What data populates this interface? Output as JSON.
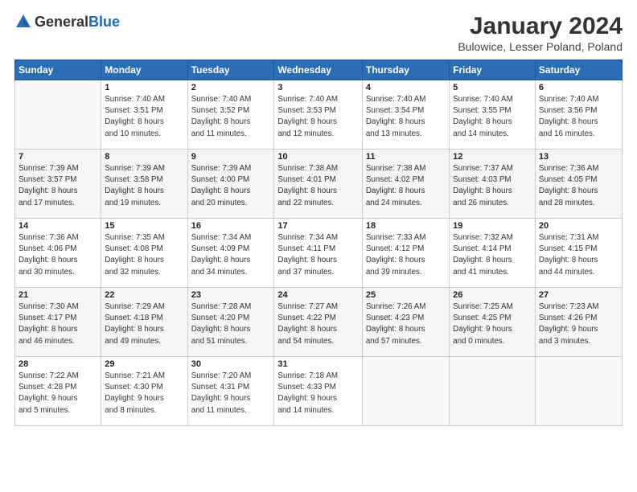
{
  "header": {
    "logo_general": "General",
    "logo_blue": "Blue",
    "month": "January 2024",
    "location": "Bulowice, Lesser Poland, Poland"
  },
  "weekdays": [
    "Sunday",
    "Monday",
    "Tuesday",
    "Wednesday",
    "Thursday",
    "Friday",
    "Saturday"
  ],
  "weeks": [
    [
      {
        "day": "",
        "info": ""
      },
      {
        "day": "1",
        "info": "Sunrise: 7:40 AM\nSunset: 3:51 PM\nDaylight: 8 hours\nand 10 minutes."
      },
      {
        "day": "2",
        "info": "Sunrise: 7:40 AM\nSunset: 3:52 PM\nDaylight: 8 hours\nand 11 minutes."
      },
      {
        "day": "3",
        "info": "Sunrise: 7:40 AM\nSunset: 3:53 PM\nDaylight: 8 hours\nand 12 minutes."
      },
      {
        "day": "4",
        "info": "Sunrise: 7:40 AM\nSunset: 3:54 PM\nDaylight: 8 hours\nand 13 minutes."
      },
      {
        "day": "5",
        "info": "Sunrise: 7:40 AM\nSunset: 3:55 PM\nDaylight: 8 hours\nand 14 minutes."
      },
      {
        "day": "6",
        "info": "Sunrise: 7:40 AM\nSunset: 3:56 PM\nDaylight: 8 hours\nand 16 minutes."
      }
    ],
    [
      {
        "day": "7",
        "info": "Sunrise: 7:39 AM\nSunset: 3:57 PM\nDaylight: 8 hours\nand 17 minutes."
      },
      {
        "day": "8",
        "info": "Sunrise: 7:39 AM\nSunset: 3:58 PM\nDaylight: 8 hours\nand 19 minutes."
      },
      {
        "day": "9",
        "info": "Sunrise: 7:39 AM\nSunset: 4:00 PM\nDaylight: 8 hours\nand 20 minutes."
      },
      {
        "day": "10",
        "info": "Sunrise: 7:38 AM\nSunset: 4:01 PM\nDaylight: 8 hours\nand 22 minutes."
      },
      {
        "day": "11",
        "info": "Sunrise: 7:38 AM\nSunset: 4:02 PM\nDaylight: 8 hours\nand 24 minutes."
      },
      {
        "day": "12",
        "info": "Sunrise: 7:37 AM\nSunset: 4:03 PM\nDaylight: 8 hours\nand 26 minutes."
      },
      {
        "day": "13",
        "info": "Sunrise: 7:36 AM\nSunset: 4:05 PM\nDaylight: 8 hours\nand 28 minutes."
      }
    ],
    [
      {
        "day": "14",
        "info": "Sunrise: 7:36 AM\nSunset: 4:06 PM\nDaylight: 8 hours\nand 30 minutes."
      },
      {
        "day": "15",
        "info": "Sunrise: 7:35 AM\nSunset: 4:08 PM\nDaylight: 8 hours\nand 32 minutes."
      },
      {
        "day": "16",
        "info": "Sunrise: 7:34 AM\nSunset: 4:09 PM\nDaylight: 8 hours\nand 34 minutes."
      },
      {
        "day": "17",
        "info": "Sunrise: 7:34 AM\nSunset: 4:11 PM\nDaylight: 8 hours\nand 37 minutes."
      },
      {
        "day": "18",
        "info": "Sunrise: 7:33 AM\nSunset: 4:12 PM\nDaylight: 8 hours\nand 39 minutes."
      },
      {
        "day": "19",
        "info": "Sunrise: 7:32 AM\nSunset: 4:14 PM\nDaylight: 8 hours\nand 41 minutes."
      },
      {
        "day": "20",
        "info": "Sunrise: 7:31 AM\nSunset: 4:15 PM\nDaylight: 8 hours\nand 44 minutes."
      }
    ],
    [
      {
        "day": "21",
        "info": "Sunrise: 7:30 AM\nSunset: 4:17 PM\nDaylight: 8 hours\nand 46 minutes."
      },
      {
        "day": "22",
        "info": "Sunrise: 7:29 AM\nSunset: 4:18 PM\nDaylight: 8 hours\nand 49 minutes."
      },
      {
        "day": "23",
        "info": "Sunrise: 7:28 AM\nSunset: 4:20 PM\nDaylight: 8 hours\nand 51 minutes."
      },
      {
        "day": "24",
        "info": "Sunrise: 7:27 AM\nSunset: 4:22 PM\nDaylight: 8 hours\nand 54 minutes."
      },
      {
        "day": "25",
        "info": "Sunrise: 7:26 AM\nSunset: 4:23 PM\nDaylight: 8 hours\nand 57 minutes."
      },
      {
        "day": "26",
        "info": "Sunrise: 7:25 AM\nSunset: 4:25 PM\nDaylight: 9 hours\nand 0 minutes."
      },
      {
        "day": "27",
        "info": "Sunrise: 7:23 AM\nSunset: 4:26 PM\nDaylight: 9 hours\nand 3 minutes."
      }
    ],
    [
      {
        "day": "28",
        "info": "Sunrise: 7:22 AM\nSunset: 4:28 PM\nDaylight: 9 hours\nand 5 minutes."
      },
      {
        "day": "29",
        "info": "Sunrise: 7:21 AM\nSunset: 4:30 PM\nDaylight: 9 hours\nand 8 minutes."
      },
      {
        "day": "30",
        "info": "Sunrise: 7:20 AM\nSunset: 4:31 PM\nDaylight: 9 hours\nand 11 minutes."
      },
      {
        "day": "31",
        "info": "Sunrise: 7:18 AM\nSunset: 4:33 PM\nDaylight: 9 hours\nand 14 minutes."
      },
      {
        "day": "",
        "info": ""
      },
      {
        "day": "",
        "info": ""
      },
      {
        "day": "",
        "info": ""
      }
    ]
  ]
}
